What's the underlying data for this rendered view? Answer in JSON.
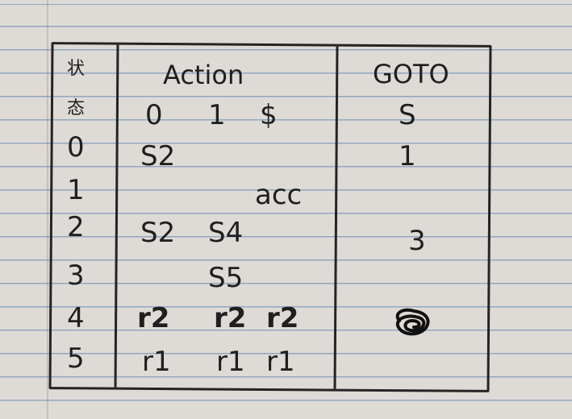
{
  "table": {
    "headers": {
      "state_top": "状",
      "state_bottom": "态",
      "action": "Action",
      "goto": "GOTO"
    },
    "action_symbols": [
      "0",
      "1",
      "$"
    ],
    "goto_symbols": [
      "S"
    ],
    "rows": [
      {
        "state": "0",
        "action": [
          "S2",
          "",
          ""
        ],
        "goto": "1"
      },
      {
        "state": "1",
        "action": [
          "",
          "",
          "acc"
        ],
        "goto": ""
      },
      {
        "state": "2",
        "action": [
          "S2",
          "S4",
          ""
        ],
        "goto": "3"
      },
      {
        "state": "3",
        "action": [
          "",
          "S5",
          ""
        ],
        "goto": ""
      },
      {
        "state": "4",
        "action": [
          "r2",
          "r2",
          "r2"
        ],
        "goto": ""
      },
      {
        "state": "5",
        "action": [
          "r1",
          "r1",
          "r1"
        ],
        "goto": ""
      }
    ],
    "scribble_note": "crossed-out entry"
  },
  "colors": {
    "ink": "#1f1f1f",
    "paper": "#dedbd6",
    "rule_lines": "#93a6be"
  }
}
